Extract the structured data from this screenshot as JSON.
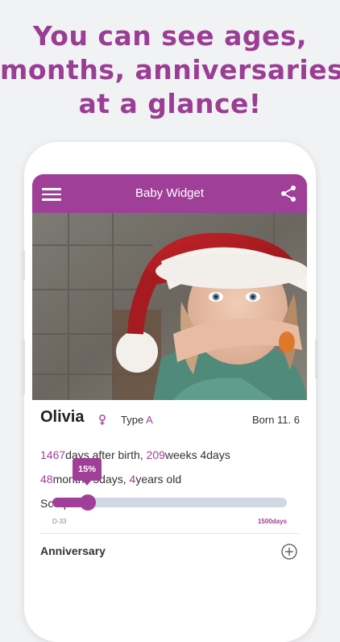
{
  "headline": {
    "line1": "You can see ages,",
    "line2": "months, anniversaries",
    "line3": "at a glance!"
  },
  "colors": {
    "accent": "#a03f97",
    "headline": "#9b3d94",
    "track": "#cfd8e3"
  },
  "appbar": {
    "title": "Baby Widget",
    "menu_icon": "hamburger-icon",
    "share_icon": "share-icon"
  },
  "profile": {
    "name": "Olivia",
    "gender_icon": "female-icon",
    "type_label": "Type",
    "type_value": "A",
    "born": "Born 11. 6"
  },
  "stats": {
    "days": "1467",
    "days_text": "days after birth, ",
    "weeks": "209",
    "weeks_text": "weeks 4days",
    "months": "48",
    "months_text": "months 5days, ",
    "years": "4",
    "years_text": "years old",
    "zodiac": "Scorpio"
  },
  "progress": {
    "label": "15%",
    "percent": 15,
    "start_label": "D-33",
    "end_label": "1500days"
  },
  "anniversary": {
    "title": "Anniversary",
    "add_icon": "add-icon"
  }
}
